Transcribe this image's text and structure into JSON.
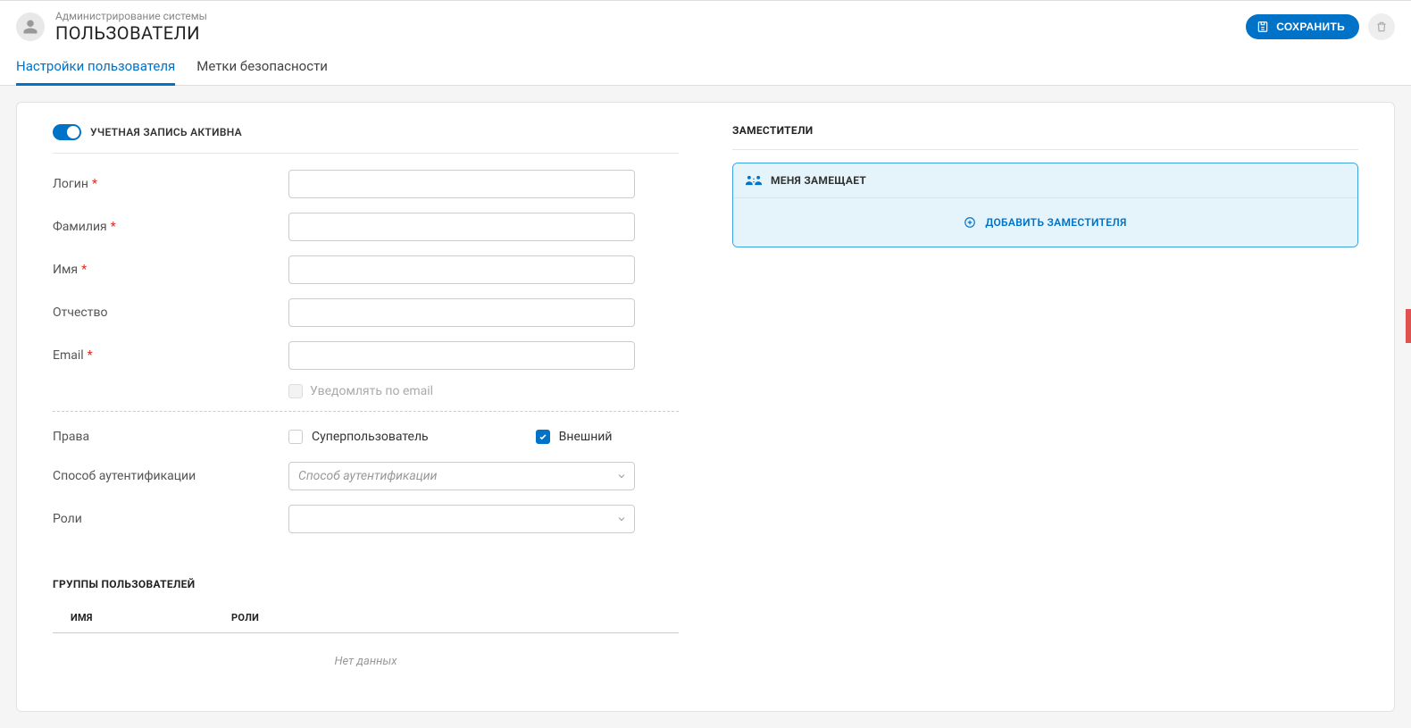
{
  "header": {
    "breadcrumb": "Администрирование системы",
    "title": "ПОЛЬЗОВАТЕЛИ",
    "save_label": "СОХРАНИТЬ"
  },
  "tabs": [
    {
      "label": "Настройки пользователя",
      "active": true
    },
    {
      "label": "Метки безопасности",
      "active": false
    }
  ],
  "form": {
    "account_active_label": "УЧЕТНАЯ ЗАПИСЬ АКТИВНА",
    "account_active": true,
    "login_label": "Логин",
    "login": "",
    "lastname_label": "Фамилия",
    "lastname": "",
    "firstname_label": "Имя",
    "firstname": "",
    "middlename_label": "Отчество",
    "middlename": "",
    "email_label": "Email",
    "email": "",
    "notify_email_label": "Уведомлять по email",
    "notify_email": false,
    "rights_label": "Права",
    "superuser_label": "Суперпользователь",
    "superuser": false,
    "external_label": "Внешний",
    "external": true,
    "auth_method_label": "Способ аутентификации",
    "auth_method_placeholder": "Способ аутентификации",
    "roles_label": "Роли"
  },
  "groups": {
    "title": "ГРУППЫ ПОЛЬЗОВАТЕЛЕЙ",
    "col_name": "ИМЯ",
    "col_roles": "РОЛИ",
    "empty": "Нет данных"
  },
  "substitutes": {
    "title": "ЗАМЕСТИТЕЛИ",
    "replaces_me": "МЕНЯ ЗАМЕЩАЕТ",
    "add_label": "ДОБАВИТЬ ЗАМЕСТИТЕЛЯ"
  }
}
